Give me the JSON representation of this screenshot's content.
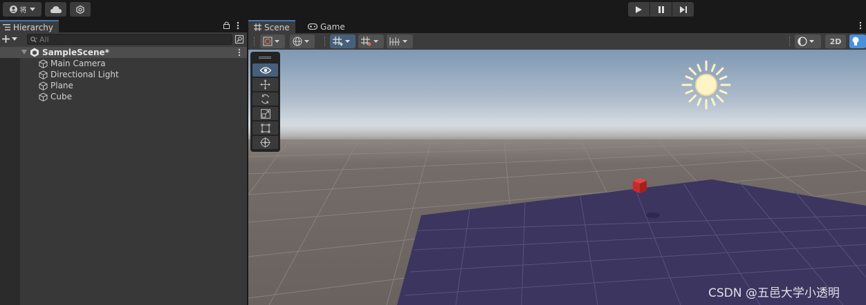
{
  "topbar": {
    "account_label": "将",
    "cloud_icon": "cloud-icon",
    "settings_icon": "collab-icon"
  },
  "hierarchy": {
    "tab_label": "Hierarchy",
    "search_placeholder": "All",
    "scene_name": "SampleScene*",
    "items": [
      {
        "label": "Main Camera"
      },
      {
        "label": "Directional Light"
      },
      {
        "label": "Plane"
      },
      {
        "label": "Cube"
      }
    ]
  },
  "scene_view": {
    "tabs": [
      {
        "label": "Scene"
      },
      {
        "label": "Game"
      }
    ],
    "mode_2d_label": "2D",
    "colors": {
      "sky": "#bcc6d0",
      "ground": "#6f6661",
      "plane": "#3b3560",
      "cube": "#cc3232",
      "accent": "#3a79bb"
    }
  },
  "watermark": "CSDN @五邑大学小透明"
}
